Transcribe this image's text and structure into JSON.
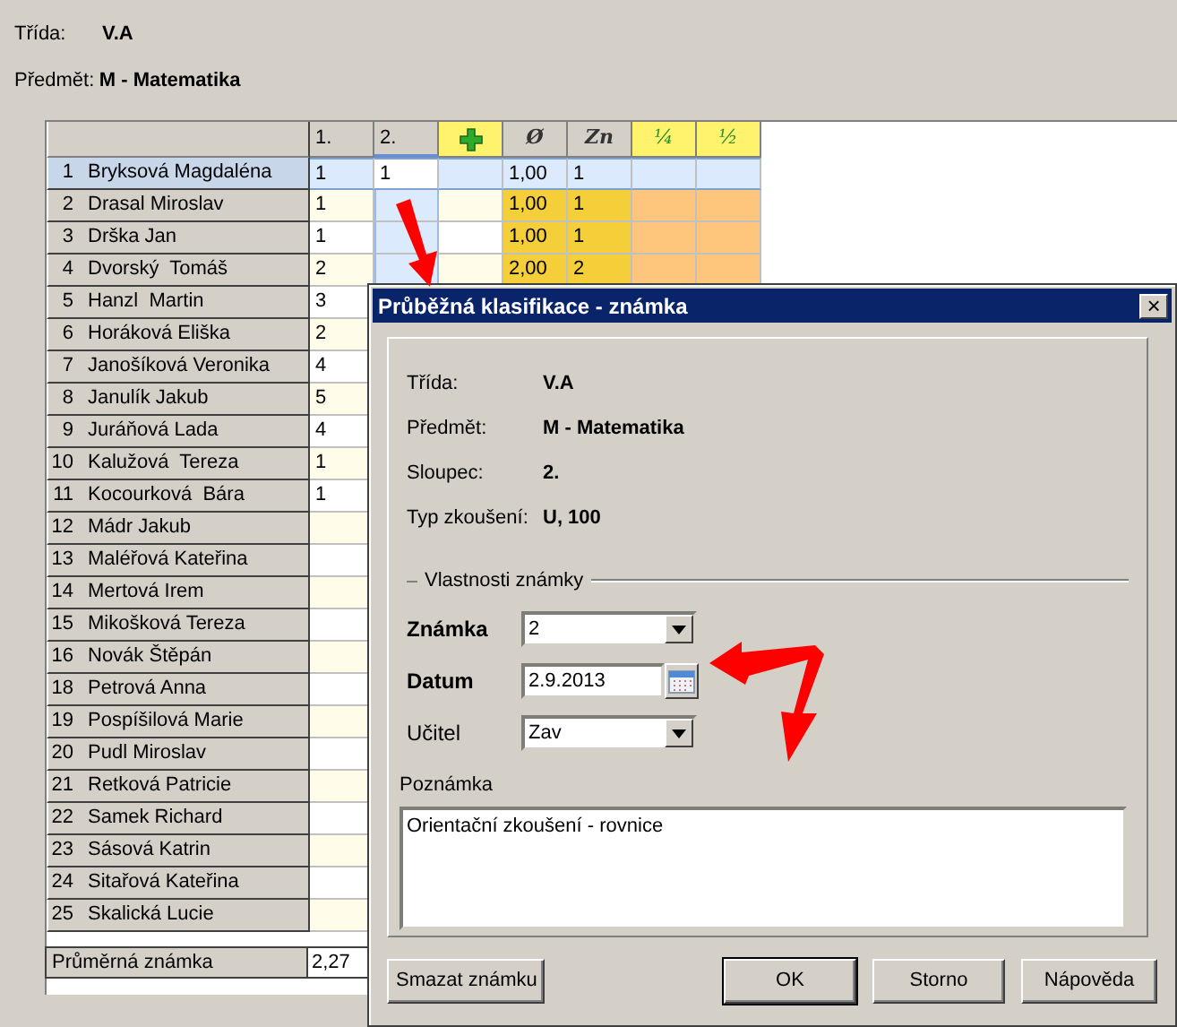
{
  "header": {
    "class_label": "Třída:",
    "class_value": "V.A",
    "subject_label": "Předmět:",
    "subject_value": "M - Matematika"
  },
  "grid": {
    "columns": [
      {
        "kind": "plain",
        "label": "1.",
        "highlighted": false,
        "selected": false
      },
      {
        "kind": "plain",
        "label": "2.",
        "highlighted": false,
        "selected": true
      },
      {
        "kind": "add",
        "highlighted": true,
        "selected": false
      },
      {
        "kind": "symbol",
        "label": "Ø",
        "highlighted": false,
        "selected": false
      },
      {
        "kind": "symbol",
        "label": "Zn",
        "highlighted": false,
        "selected": false
      },
      {
        "kind": "fraction",
        "label": "¼",
        "highlighted": true,
        "selected": false
      },
      {
        "kind": "fraction",
        "label": "½",
        "highlighted": true,
        "selected": false
      }
    ],
    "rows": [
      {
        "number": "1",
        "name": "Bryksová Magdaléna",
        "selected": true,
        "values": {
          "column_1": "1",
          "column_2": "1",
          "column_4": "1,00",
          "column_5": "1"
        }
      },
      {
        "number": "2",
        "name": "Drasal Miroslav",
        "selected": false,
        "values": {
          "column_1": "1",
          "column_4": "1,00",
          "column_5": "1"
        }
      },
      {
        "number": "3",
        "name": "Drška Jan",
        "selected": false,
        "values": {
          "column_1": "1",
          "column_4": "1,00",
          "column_5": "1"
        }
      },
      {
        "number": "4",
        "name": "Dvorský  Tomáš",
        "selected": false,
        "values": {
          "column_1": "2",
          "column_4": "2,00",
          "column_5": "2"
        }
      },
      {
        "number": "5",
        "name": "Hanzl  Martin",
        "selected": false,
        "values": {
          "column_1": "3"
        }
      },
      {
        "number": "6",
        "name": "Horáková Eliška",
        "selected": false,
        "values": {
          "column_1": "2"
        }
      },
      {
        "number": "7",
        "name": "Janošíková Veronika",
        "selected": false,
        "values": {
          "column_1": "4"
        }
      },
      {
        "number": "8",
        "name": "Janulík Jakub",
        "selected": false,
        "values": {
          "column_1": "5"
        }
      },
      {
        "number": "9",
        "name": "Juráňová Lada",
        "selected": false,
        "values": {
          "column_1": "4"
        }
      },
      {
        "number": "10",
        "name": "Kalužová  Tereza",
        "selected": false,
        "values": {
          "column_1": "1"
        }
      },
      {
        "number": "11",
        "name": "Kocourková  Bára",
        "selected": false,
        "values": {
          "column_1": "1"
        }
      },
      {
        "number": "12",
        "name": "Mádr Jakub",
        "selected": false
      },
      {
        "number": "13",
        "name": "Maléřová Kateřina",
        "selected": false
      },
      {
        "number": "14",
        "name": "Mertová Irem",
        "selected": false
      },
      {
        "number": "15",
        "name": "Mikošková Tereza",
        "selected": false
      },
      {
        "number": "16",
        "name": "Novák Štěpán",
        "selected": false
      },
      {
        "number": "18",
        "name": "Petrová Anna",
        "selected": false
      },
      {
        "number": "19",
        "name": "Pospíšilová Marie",
        "selected": false
      },
      {
        "number": "20",
        "name": "Pudl Miroslav",
        "selected": false
      },
      {
        "number": "21",
        "name": "Retková Patricie",
        "selected": false
      },
      {
        "number": "22",
        "name": "Samek Richard",
        "selected": false
      },
      {
        "number": "23",
        "name": "Sásová Katrin",
        "selected": false
      },
      {
        "number": "24",
        "name": "Sitařová Kateřina",
        "selected": false
      },
      {
        "number": "25",
        "name": "Skalická Lucie",
        "selected": false
      }
    ],
    "footer": {
      "label": "Průměrná známka",
      "value": "2,27"
    }
  },
  "dialog": {
    "title": "Průběžná klasifikace - známka",
    "close": "×",
    "info": [
      {
        "label": "Třída:",
        "value": "V.A"
      },
      {
        "label": "Předmět:",
        "value": "M - Matematika"
      },
      {
        "label": "Sloupec:",
        "value": "2."
      },
      {
        "label": "Typ zkoušení:",
        "value": "U, 100"
      }
    ],
    "group_title": "Vlastnosti známky",
    "fields": [
      {
        "kind": "combo",
        "label": "Známka",
        "value": "2",
        "emphasized": true
      },
      {
        "kind": "date",
        "label": "Datum",
        "value": "2.9.2013",
        "emphasized": true
      },
      {
        "kind": "combo",
        "label": "Učitel",
        "value": "Zav",
        "emphasized": false
      }
    ],
    "note": {
      "label": "Poznámka",
      "value": "Orientační zkoušení - rovnice"
    },
    "buttons": [
      {
        "label": "Smazat známku",
        "default": false
      },
      {
        "label": "OK",
        "default": true
      },
      {
        "label": "Storno",
        "default": false
      },
      {
        "label": "Nápověda",
        "default": false
      }
    ]
  }
}
